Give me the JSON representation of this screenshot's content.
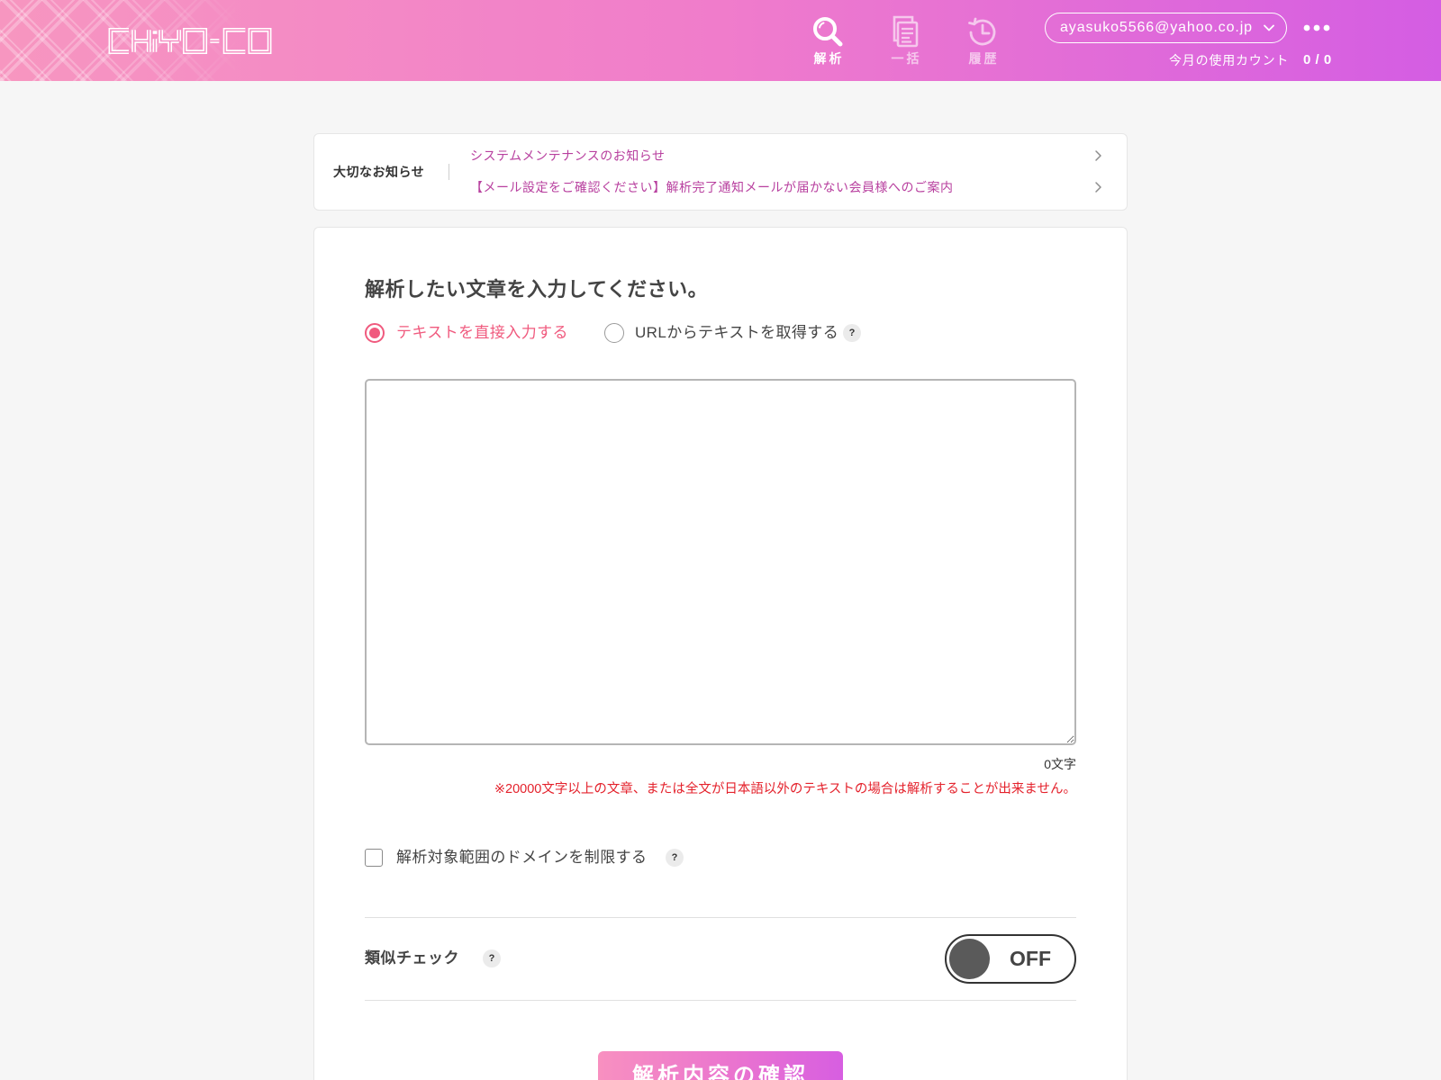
{
  "header": {
    "logo_text": "CHiYO-CO",
    "nav": [
      {
        "label": "解析",
        "icon": "search-icon",
        "active": true
      },
      {
        "label": "一括",
        "icon": "document-icon",
        "active": false
      },
      {
        "label": "履歴",
        "icon": "history-icon",
        "active": false
      }
    ],
    "account": {
      "email": "ayasuko5566@yahoo.co.jp",
      "icon": "chevron-down-icon"
    },
    "more_icon": "more-dots-icon",
    "usage": {
      "label": "今月の使用カウント",
      "value": "0 / 0"
    }
  },
  "notices": {
    "label": "大切なお知らせ",
    "items": [
      {
        "text": "システムメンテナンスのお知らせ",
        "icon": "chevron-right-icon"
      },
      {
        "text": "【メール設定をご確認ください】解析完了通知メールが届かない会員様へのご案内",
        "icon": "chevron-right-icon"
      }
    ]
  },
  "form": {
    "title": "解析したい文章を入力してください。",
    "help_mark": "?",
    "input_modes": [
      {
        "label": "テキストを直接入力する",
        "selected": true
      },
      {
        "label": "URLからテキストを取得する",
        "selected": false
      }
    ],
    "textarea_value": "",
    "char_count": "0文字",
    "warning": "※20000文字以上の文章、または全文が日本語以外のテキストの場合は解析することが出来ません。",
    "domain_limit": {
      "label": "解析対象範囲のドメインを制限する",
      "checked": false
    },
    "similarity_check": {
      "label": "類似チェック",
      "state_label": "OFF",
      "enabled": false
    },
    "submit_label": "解析内容の確認"
  },
  "colors": {
    "header_gradient": [
      "#f796c0",
      "#f07ccb",
      "#d45de3"
    ],
    "accent": "#f05a7e",
    "link": "#b8409f",
    "warning": "#e4222c"
  }
}
